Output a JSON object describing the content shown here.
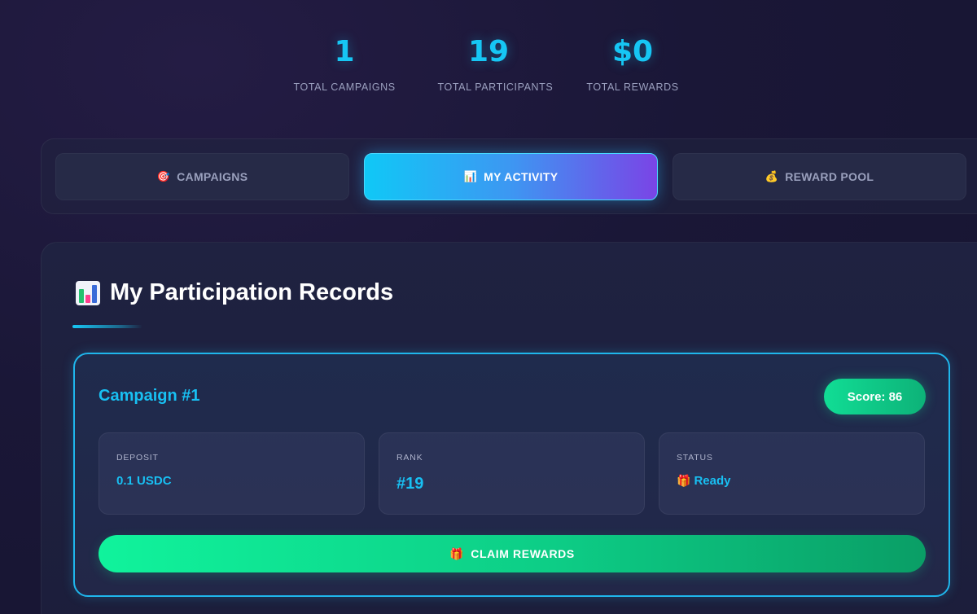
{
  "stats": [
    {
      "value": "1",
      "label": "TOTAL CAMPAIGNS"
    },
    {
      "value": "19",
      "label": "TOTAL PARTICIPANTS"
    },
    {
      "value": "$0",
      "label": "TOTAL REWARDS"
    }
  ],
  "tabs": [
    {
      "icon": "🎯",
      "label": "CAMPAIGNS",
      "active": false
    },
    {
      "icon": "📊",
      "label": "MY ACTIVITY",
      "active": true
    },
    {
      "icon": "💰",
      "label": "REWARD POOL",
      "active": false
    }
  ],
  "section": {
    "title": "My Participation Records"
  },
  "campaign": {
    "title": "Campaign #1",
    "score": "Score: 86",
    "deposit_label": "DEPOSIT",
    "deposit_value": "0.1 USDC",
    "rank_label": "RANK",
    "rank_value": "#19",
    "status_label": "STATUS",
    "status_icon": "🎁",
    "status_value": "Ready",
    "claim_icon": "🎁",
    "claim_label": "CLAIM REWARDS"
  },
  "colors": {
    "accent": "#16c6f4",
    "success": "#10f39c",
    "active_tab_start": "#10c8f6",
    "active_tab_end": "#7a44e6",
    "background": "#1a1737"
  },
  "icons": {
    "campaigns_tab": "target-icon",
    "activity_tab": "bar-chart-icon",
    "reward_pool_tab": "money-bag-icon",
    "section_title": "bar-chart-icon",
    "status": "gift-icon",
    "claim": "gift-icon"
  }
}
